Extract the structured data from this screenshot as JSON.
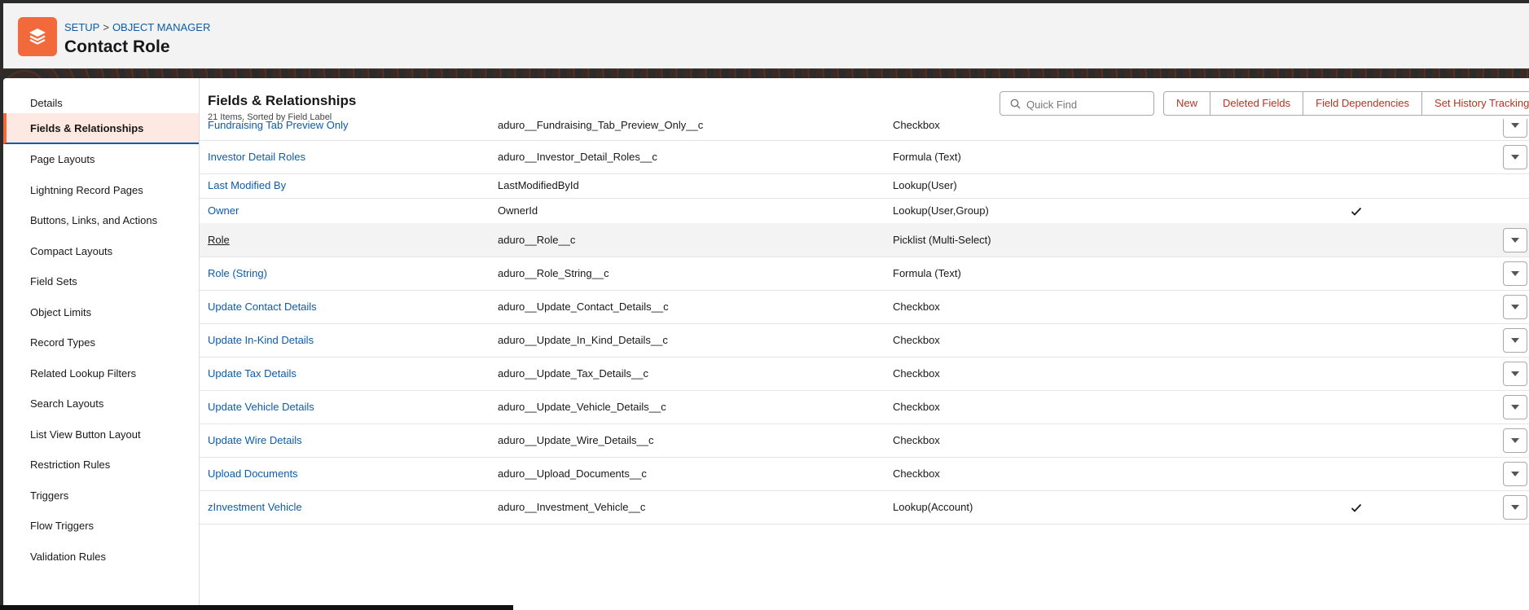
{
  "header": {
    "breadcrumb": [
      "SETUP",
      "OBJECT MANAGER"
    ],
    "breadcrumb_sep": ">",
    "title": "Contact Role"
  },
  "sidebar": {
    "items": [
      {
        "label": "Details"
      },
      {
        "label": "Fields & Relationships",
        "active": true
      },
      {
        "label": "Page Layouts"
      },
      {
        "label": "Lightning Record Pages"
      },
      {
        "label": "Buttons, Links, and Actions"
      },
      {
        "label": "Compact Layouts"
      },
      {
        "label": "Field Sets"
      },
      {
        "label": "Object Limits"
      },
      {
        "label": "Record Types"
      },
      {
        "label": "Related Lookup Filters"
      },
      {
        "label": "Search Layouts"
      },
      {
        "label": "List View Button Layout"
      },
      {
        "label": "Restriction Rules"
      },
      {
        "label": "Triggers"
      },
      {
        "label": "Flow Triggers"
      },
      {
        "label": "Validation Rules"
      }
    ]
  },
  "main": {
    "title": "Fields & Relationships",
    "subtitle": "21 Items, Sorted by Field Label",
    "search": {
      "placeholder": "Quick Find",
      "value": ""
    },
    "buttons": [
      "New",
      "Deleted Fields",
      "Field Dependencies",
      "Set History Tracking"
    ],
    "rows": [
      {
        "label": "Fundraising Tab Preview Only",
        "api": "aduro__Fundraising_Tab_Preview_Only__c",
        "type": "Checkbox",
        "indexed": false,
        "menu": true
      },
      {
        "label": "Investor Detail Roles",
        "api": "aduro__Investor_Detail_Roles__c",
        "type": "Formula (Text)",
        "indexed": false,
        "menu": true
      },
      {
        "label": "Last Modified By",
        "api": "LastModifiedById",
        "type": "Lookup(User)",
        "indexed": false,
        "menu": false
      },
      {
        "label": "Owner",
        "api": "OwnerId",
        "type": "Lookup(User,Group)",
        "indexed": true,
        "menu": false
      },
      {
        "label": "Role",
        "api": "aduro__Role__c",
        "type": "Picklist (Multi-Select)",
        "indexed": false,
        "menu": true,
        "hovered": true
      },
      {
        "label": "Role (String)",
        "api": "aduro__Role_String__c",
        "type": "Formula (Text)",
        "indexed": false,
        "menu": true
      },
      {
        "label": "Update Contact Details",
        "api": "aduro__Update_Contact_Details__c",
        "type": "Checkbox",
        "indexed": false,
        "menu": true
      },
      {
        "label": "Update In-Kind Details",
        "api": "aduro__Update_In_Kind_Details__c",
        "type": "Checkbox",
        "indexed": false,
        "menu": true
      },
      {
        "label": "Update Tax Details",
        "api": "aduro__Update_Tax_Details__c",
        "type": "Checkbox",
        "indexed": false,
        "menu": true
      },
      {
        "label": "Update Vehicle Details",
        "api": "aduro__Update_Vehicle_Details__c",
        "type": "Checkbox",
        "indexed": false,
        "menu": true
      },
      {
        "label": "Update Wire Details",
        "api": "aduro__Update_Wire_Details__c",
        "type": "Checkbox",
        "indexed": false,
        "menu": true
      },
      {
        "label": "Upload Documents",
        "api": "aduro__Upload_Documents__c",
        "type": "Checkbox",
        "indexed": false,
        "menu": true
      },
      {
        "label": "zInvestment Vehicle",
        "api": "aduro__Investment_Vehicle__c",
        "type": "Lookup(Account)",
        "indexed": true,
        "menu": true
      }
    ]
  },
  "colors": {
    "accent": "#f2693b",
    "link": "#0b5cab",
    "button_text": "#b4341f"
  },
  "icons": {
    "object": "stack-layers-icon",
    "search": "search-icon",
    "check": "checkmark-icon",
    "row_menu": "chevron-down-icon"
  }
}
